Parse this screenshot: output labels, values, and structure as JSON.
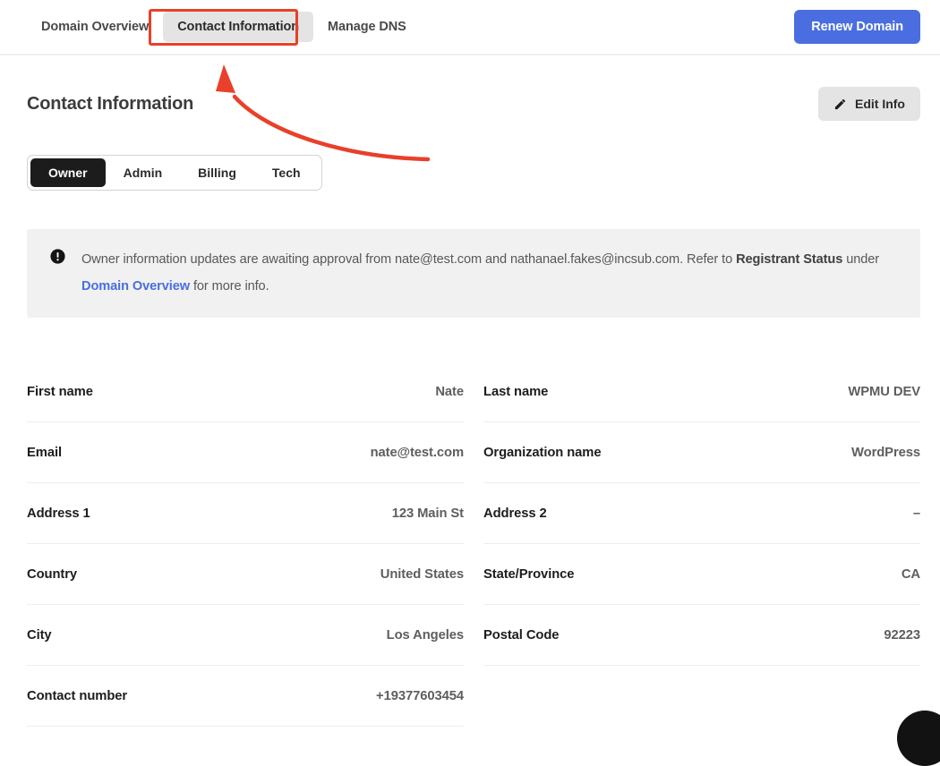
{
  "topbar": {
    "tabs": [
      {
        "label": "Domain Overview",
        "active": false
      },
      {
        "label": "Contact Information",
        "active": true
      },
      {
        "label": "Manage DNS",
        "active": false
      }
    ],
    "renew_button": "Renew Domain"
  },
  "header": {
    "title": "Contact Information",
    "edit_button": "Edit Info",
    "edit_icon": "pencil-icon"
  },
  "contact_type_tabs": [
    {
      "label": "Owner",
      "active": true
    },
    {
      "label": "Admin",
      "active": false
    },
    {
      "label": "Billing",
      "active": false
    },
    {
      "label": "Tech",
      "active": false
    }
  ],
  "notice": {
    "icon": "exclamation-circle-icon",
    "part1": "Owner information updates are awaiting approval from nate@test.com and nathanael.fakes@incsub.com. Refer to ",
    "bold1": "Registrant Status",
    "part2": " under ",
    "link": "Domain Overview",
    "part3": " for more info."
  },
  "details": {
    "left": [
      {
        "label": "First name",
        "value": "Nate"
      },
      {
        "label": "Email",
        "value": "nate@test.com"
      },
      {
        "label": "Address 1",
        "value": "123 Main St"
      },
      {
        "label": "Country",
        "value": "United States"
      },
      {
        "label": "City",
        "value": "Los Angeles"
      },
      {
        "label": "Contact number",
        "value": "+19377603454"
      }
    ],
    "right": [
      {
        "label": "Last name",
        "value": "WPMU DEV"
      },
      {
        "label": "Organization name",
        "value": "WordPress"
      },
      {
        "label": "Address 2",
        "value": "–"
      },
      {
        "label": "State/Province",
        "value": "CA"
      },
      {
        "label": "Postal Code",
        "value": "92223"
      }
    ]
  },
  "annotation": {
    "color": "#e8402a",
    "shape": "curved-arrow-pointing-to-contact-information-tab"
  },
  "support_widget": {
    "icon": "support-bubble-icon",
    "color": "#121212"
  }
}
